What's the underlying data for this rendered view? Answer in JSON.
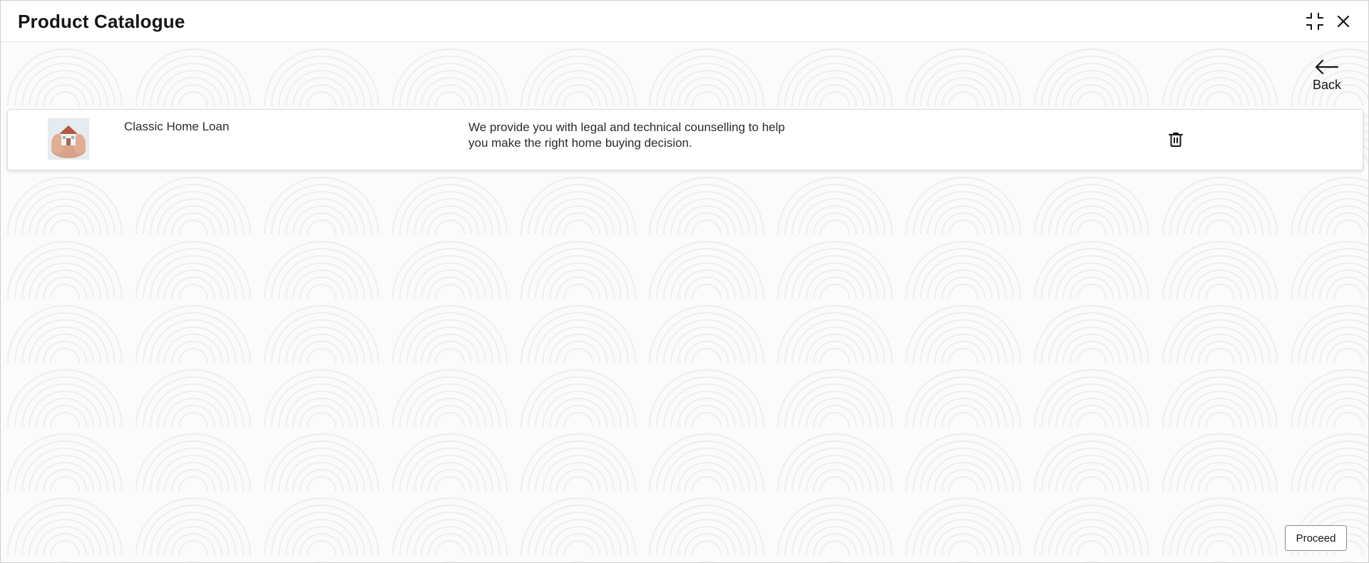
{
  "window": {
    "title": "Product Catalogue"
  },
  "header_icons": {
    "minimize": "compress-icon",
    "close": "close-icon"
  },
  "back": {
    "label": "Back",
    "icon": "arrow-left-icon"
  },
  "products": [
    {
      "name": "Classic Home Loan",
      "description": "We provide you with legal and technical counselling to help you make the right home buying decision.",
      "thumbnail_icon": "house-in-hands-image",
      "action_icon": "trash-icon"
    }
  ],
  "footer": {
    "proceed_label": "Proceed"
  },
  "colors": {
    "text": "#161513",
    "border": "#dedede",
    "background": "#fbfbfb"
  }
}
